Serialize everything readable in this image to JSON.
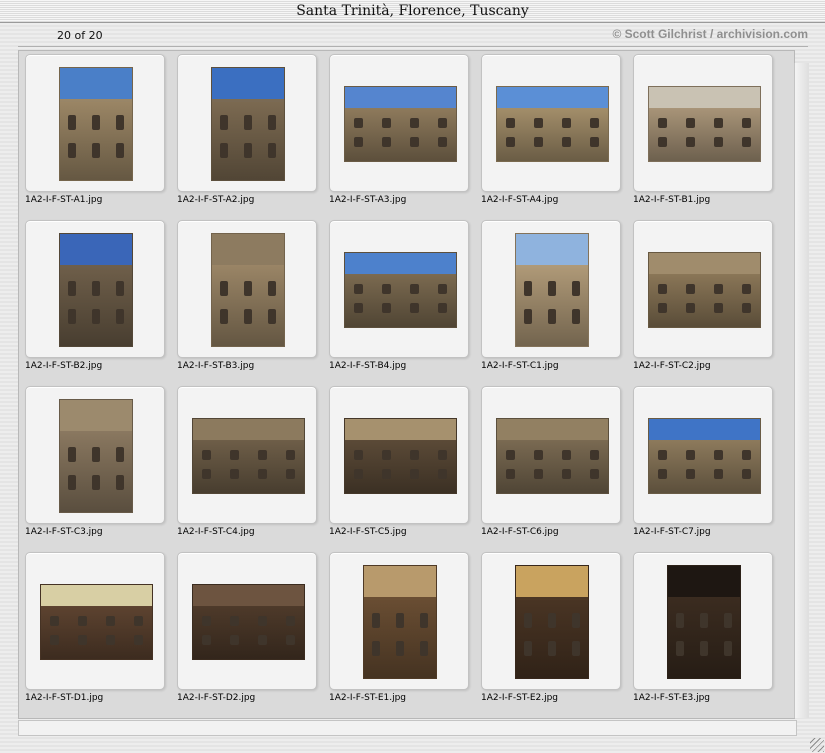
{
  "window": {
    "title": "Santa Trinità, Florence, Tuscany"
  },
  "header": {
    "counter": "20 of 20",
    "credit": "© Scott Gilchrist / archivision.com"
  },
  "thumbnails": [
    {
      "caption": "1A2-I-F-ST-A1.jpg",
      "orient": "portrait",
      "sky": "#4a7fc8",
      "tone": "#9c8766"
    },
    {
      "caption": "1A2-I-F-ST-A2.jpg",
      "orient": "portrait",
      "sky": "#3b6fc1",
      "tone": "#7d6b52"
    },
    {
      "caption": "1A2-I-F-ST-A3.jpg",
      "orient": "landscape",
      "sky": "#5585cf",
      "tone": "#8e7a5c"
    },
    {
      "caption": "1A2-I-F-ST-A4.jpg",
      "orient": "landscape",
      "sky": "#5b8fd6",
      "tone": "#a38e6a"
    },
    {
      "caption": "1A2-I-F-ST-B1.jpg",
      "orient": "landscape",
      "sky": "#c9c2b3",
      "tone": "#a89478"
    },
    {
      "caption": "1A2-I-F-ST-B2.jpg",
      "orient": "portrait",
      "sky": "#3a66b8",
      "tone": "#6f5f4a"
    },
    {
      "caption": "1A2-I-F-ST-B3.jpg",
      "orient": "portrait",
      "sky": "#8d7b60",
      "tone": "#9a8566"
    },
    {
      "caption": "1A2-I-F-ST-B4.jpg",
      "orient": "landscape",
      "sky": "#4d81cc",
      "tone": "#7b6a50"
    },
    {
      "caption": "1A2-I-F-ST-C1.jpg",
      "orient": "portrait",
      "sky": "#8fb3de",
      "tone": "#b09a78"
    },
    {
      "caption": "1A2-I-F-ST-C2.jpg",
      "orient": "landscape",
      "sky": "#a08c6c",
      "tone": "#8a7657"
    },
    {
      "caption": "1A2-I-F-ST-C3.jpg",
      "orient": "portrait",
      "sky": "#9c8a6d",
      "tone": "#8a7860"
    },
    {
      "caption": "1A2-I-F-ST-C4.jpg",
      "orient": "landscape",
      "sky": "#8c7a5e",
      "tone": "#6e5e48"
    },
    {
      "caption": "1A2-I-F-ST-C5.jpg",
      "orient": "landscape",
      "sky": "#a6916e",
      "tone": "#5b4a37"
    },
    {
      "caption": "1A2-I-F-ST-C6.jpg",
      "orient": "landscape",
      "sky": "#928062",
      "tone": "#7a6a52"
    },
    {
      "caption": "1A2-I-F-ST-C7.jpg",
      "orient": "landscape",
      "sky": "#3f74c6",
      "tone": "#8d7a5c"
    },
    {
      "caption": "1A2-I-F-ST-D1.jpg",
      "orient": "landscape",
      "sky": "#d8cfa4",
      "tone": "#5d4330"
    },
    {
      "caption": "1A2-I-F-ST-D2.jpg",
      "orient": "landscape",
      "sky": "#6d5440",
      "tone": "#4e3a2a"
    },
    {
      "caption": "1A2-I-F-ST-E1.jpg",
      "orient": "portrait",
      "sky": "#b89a6c",
      "tone": "#6a4e33"
    },
    {
      "caption": "1A2-I-F-ST-E2.jpg",
      "orient": "portrait",
      "sky": "#c9a35f",
      "tone": "#4a3524"
    },
    {
      "caption": "1A2-I-F-ST-E3.jpg",
      "orient": "portrait",
      "sky": "#1e1712",
      "tone": "#3b2c20"
    }
  ]
}
